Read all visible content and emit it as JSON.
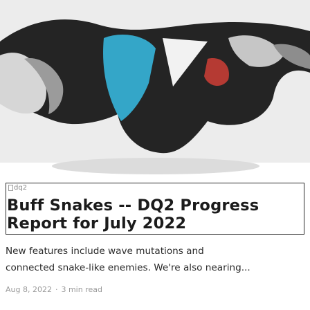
{
  "post": {
    "image_alt": "dq2",
    "title": "Buff Snakes -- DQ2 Progress Report for July 2022",
    "excerpt_line1": "New features include wave mutations and",
    "excerpt_line2": "connected snake-like enemies. We're also nearing...",
    "date": "Aug 8, 2022",
    "separator": "·",
    "read_time": "3 min read"
  },
  "colors": {
    "sky": "#ededed",
    "snake_dark": "#242424",
    "snake_blue": "#34a6c8",
    "border": "#2a2a2a",
    "meta_text": "#9a9a9a"
  }
}
